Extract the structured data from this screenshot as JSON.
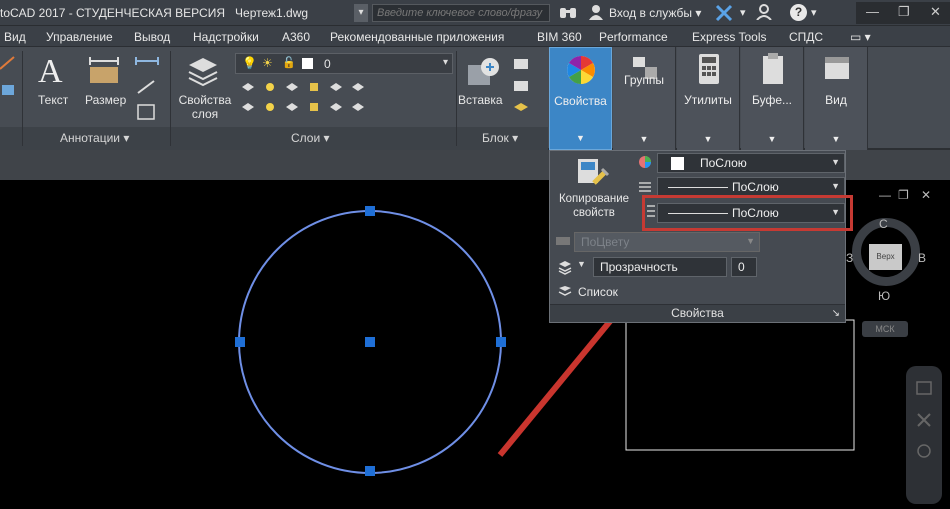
{
  "titlebar": {
    "app_title": "toCAD 2017 - СТУДЕНЧЕСКАЯ ВЕРСИЯ",
    "file_name": "Чертеж1.dwg",
    "search_placeholder": "Введите ключевое слово/фразу",
    "login_label": "Вход в службы"
  },
  "menu": {
    "items": [
      "Вид",
      "Управление",
      "Вывод",
      "Надстройки",
      "A360",
      "Рекомендованные приложения",
      "BIM 360",
      "Performance",
      "Express Tools",
      "СПДС"
    ]
  },
  "ribbon": {
    "text_button": "Текст",
    "dimension_button": "Размер",
    "annotations_panel": "Аннотации",
    "layer_props_line1": "Свойства",
    "layer_props_line2": "слоя",
    "layer_value": "0",
    "layers_panel": "Слои",
    "insert_button": "Вставка",
    "block_panel": "Блок",
    "properties_tab": "Свойства",
    "groups_tab": "Группы",
    "utilities_tab": "Утилиты",
    "clipboard_tab": "Буфе...",
    "view_tab": "Вид"
  },
  "properties_flyout": {
    "copy_props_line1": "Копирование",
    "copy_props_line2": "свойств",
    "color_value": "ПоСлою",
    "linetype_value": "ПоСлою",
    "lineweight_value": "ПоСлою",
    "plotstyle_value": "ПоЦвету",
    "transparency_label": "Прозрачность",
    "transparency_value": "0",
    "list_label": "Список",
    "panel_title": "Свойства"
  },
  "viewcube": {
    "north": "С",
    "east": "В",
    "west": "З",
    "south": "Ю",
    "top_face": "Верх",
    "wcs": "МСК"
  },
  "colors": {
    "accent_blue": "#3c86c6",
    "highlight_red": "#c63a33",
    "circle_blue": "#6f8fe6",
    "grip_blue": "#1f6fd6"
  }
}
